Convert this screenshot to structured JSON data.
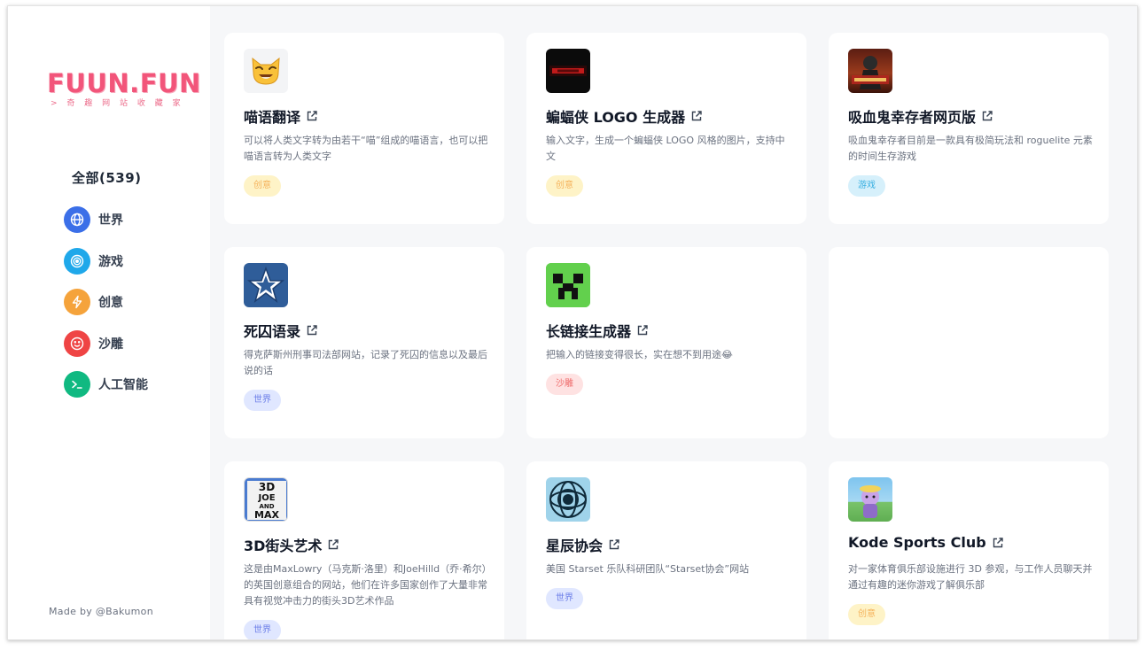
{
  "logo": {
    "text": "FUUN.FUN",
    "subtitle": "> 奇 趣 网 站 收 藏 家"
  },
  "nav": {
    "all_label": "全部(539)",
    "items": [
      {
        "label": "世界",
        "icon": "globe-icon",
        "color": "#3b6fe8"
      },
      {
        "label": "游戏",
        "icon": "target-icon",
        "color": "#1fa8ea"
      },
      {
        "label": "创意",
        "icon": "lightning-icon",
        "color": "#f5a33b"
      },
      {
        "label": "沙雕",
        "icon": "smile-icon",
        "color": "#ef4444"
      },
      {
        "label": "人工智能",
        "icon": "terminal-icon",
        "color": "#10b981"
      }
    ]
  },
  "footer": {
    "made_by": "Made by @Bakumon"
  },
  "cards": [
    {
      "title": "喵语翻译",
      "desc": "可以将人类文字转为由若干“喵”组成的喵语言，也可以把喵语言转为人类文字",
      "tag": "创意",
      "tag_type": "create",
      "thumb": "cat-emoji"
    },
    {
      "title": "蝙蝠侠 LOGO 生成器",
      "desc": "输入文字，生成一个蝙蝠侠 LOGO 风格的图片，支持中文",
      "tag": "创意",
      "tag_type": "create",
      "thumb": "batman-logo"
    },
    {
      "title": "吸血鬼幸存者网页版",
      "desc": "吸血鬼幸存者目前是一款具有极简玩法和 roguelite 元素的时间生存游戏",
      "tag": "游戏",
      "tag_type": "game",
      "thumb": "vampire-survivors"
    },
    {
      "title": "死囚语录",
      "desc": "得克萨斯州刑事司法部网站，记录了死囚的信息以及最后说的话",
      "tag": "世界",
      "tag_type": "world",
      "thumb": "texas-star"
    },
    {
      "title": "长链接生成器",
      "desc": "把输入的链接变得很长，实在想不到用途",
      "desc_emoji": "😂",
      "tag": "沙雕",
      "tag_type": "fun",
      "thumb": "creeper"
    },
    {
      "title": "",
      "desc": "",
      "tag": "",
      "tag_type": "",
      "thumb": "empty"
    },
    {
      "title": "3D街头艺术",
      "desc": "这是由MaxLowry（马克斯·洛里）和JoeHilld（乔·希尔）的英国创意组合的网站，他们在许多国家创作了大量非常具有视觉冲击力的街头3D艺术作品",
      "tag": "世界",
      "tag_type": "world",
      "thumb": "3d-joe-max",
      "thumb_text": [
        "3D",
        "JOE",
        "AND",
        "MAX"
      ]
    },
    {
      "title": "星辰协会",
      "desc": "美国 Starset 乐队科研团队“Starset协会”网站",
      "tag": "世界",
      "tag_type": "world",
      "thumb": "starset-orb"
    },
    {
      "title": "Kode Sports Club",
      "desc": "对一家体育俱乐部设施进行 3D 参观，与工作人员聊天并通过有趣的迷你游戏了解俱乐部",
      "tag": "创意",
      "tag_type": "create",
      "thumb": "kode-club"
    }
  ]
}
